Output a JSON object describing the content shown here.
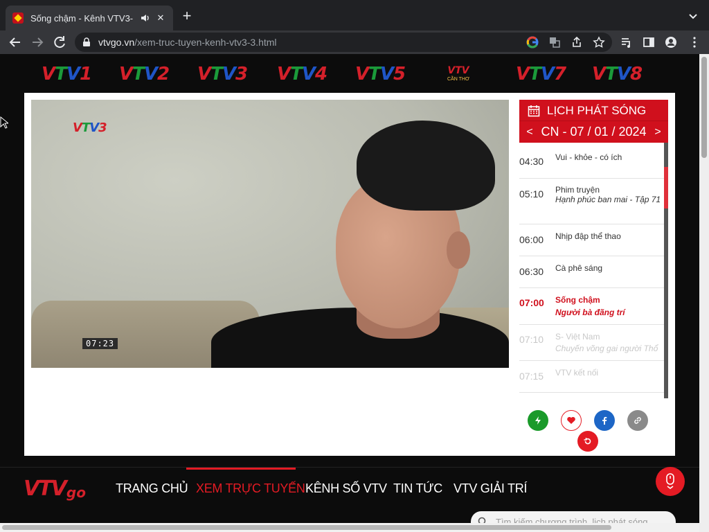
{
  "browser": {
    "tab_title": "Sống chậm - Kênh VTV3-",
    "tab_close": "✕",
    "new_tab": "+",
    "url_domain": "vtvgo.vn",
    "url_path": "/xem-truc-tuyen-kenh-vtv3-3.html"
  },
  "channels": [
    {
      "v1": "V",
      "v2": "T",
      "v3": "V",
      "num": "1"
    },
    {
      "v1": "V",
      "v2": "T",
      "v3": "V",
      "num": "2"
    },
    {
      "v1": "V",
      "v2": "T",
      "v3": "V",
      "num": "3"
    },
    {
      "v1": "V",
      "v2": "T",
      "v3": "V",
      "num": "4"
    },
    {
      "v1": "V",
      "v2": "T",
      "v3": "V",
      "num": "5"
    },
    {
      "top": "VTV",
      "bottom": "CẦN THƠ"
    },
    {
      "v1": "V",
      "v2": "T",
      "v3": "V",
      "num": "7"
    },
    {
      "v1": "V",
      "v2": "T",
      "v3": "V",
      "num": "8"
    }
  ],
  "video": {
    "logo": {
      "v1": "V",
      "v2": "T",
      "v3": "V",
      "num": "3"
    },
    "timestamp": "07:23"
  },
  "schedule": {
    "title": "LỊCH PHÁT SÓNG",
    "prev": "<",
    "next": ">",
    "date": "CN - 07 / 01 / 2024",
    "items": [
      {
        "time": "04:30",
        "title": "Vui - khỏe - có ích",
        "subtitle": ""
      },
      {
        "time": "05:10",
        "title": "Phim truyện",
        "subtitle": "Hạnh phúc ban mai - Tập 71"
      },
      {
        "time": "06:00",
        "title": "Nhịp đập thể thao",
        "subtitle": ""
      },
      {
        "time": "06:30",
        "title": "Cà phê sáng",
        "subtitle": ""
      },
      {
        "time": "07:00",
        "title": "Sống chậm",
        "subtitle": "Người bà đãng trí"
      },
      {
        "time": "07:10",
        "title": "S- Việt Nam",
        "subtitle": "Chuyến võng gai người Thổ"
      },
      {
        "time": "07:15",
        "title": "VTV kết nối",
        "subtitle": ""
      }
    ]
  },
  "actions": {
    "colors": {
      "flash": "#1a9a2a",
      "heart": "#e41b24",
      "facebook": "#1d66c6",
      "link": "#8a8a8a",
      "replay": "#e41b24"
    }
  },
  "nav": {
    "logo_vtv": "VTV",
    "logo_go": "go",
    "items": [
      "TRANG CHỦ",
      "XEM TRỰC TUYẾN",
      "KÊNH SỐ VTV",
      "TIN TỨC",
      "VTV GIẢI TRÍ"
    ]
  },
  "search": {
    "placeholder": "Tìm kiếm chương trình, lịch phát sóng"
  },
  "colors": {
    "brand_red": "#d0101d",
    "page_bg": "#0c0c0c"
  }
}
